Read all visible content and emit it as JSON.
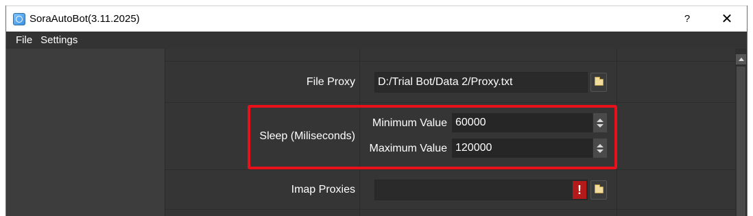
{
  "window": {
    "title": "SoraAutoBot(3.11.2025)",
    "help_label": "?",
    "close_label": "✕"
  },
  "menu": {
    "items": [
      "File",
      "Settings"
    ]
  },
  "form": {
    "file_proxy": {
      "label": "File Proxy",
      "value": "D:/Trial Bot/Data 2/Proxy.txt"
    },
    "sleep": {
      "label": "Sleep (Miliseconds)",
      "min_label": "Minimum Value",
      "min_value": "60000",
      "max_label": "Maximum Value",
      "max_value": "120000"
    },
    "imap_proxies": {
      "label": "Imap Proxies",
      "value": "",
      "warning_symbol": "!"
    }
  },
  "colors": {
    "highlight": "#e8101a",
    "warning": "#b51a1a"
  },
  "icons": {
    "app": "app-icon",
    "browse": "folder-icon",
    "warning": "warning-icon"
  }
}
